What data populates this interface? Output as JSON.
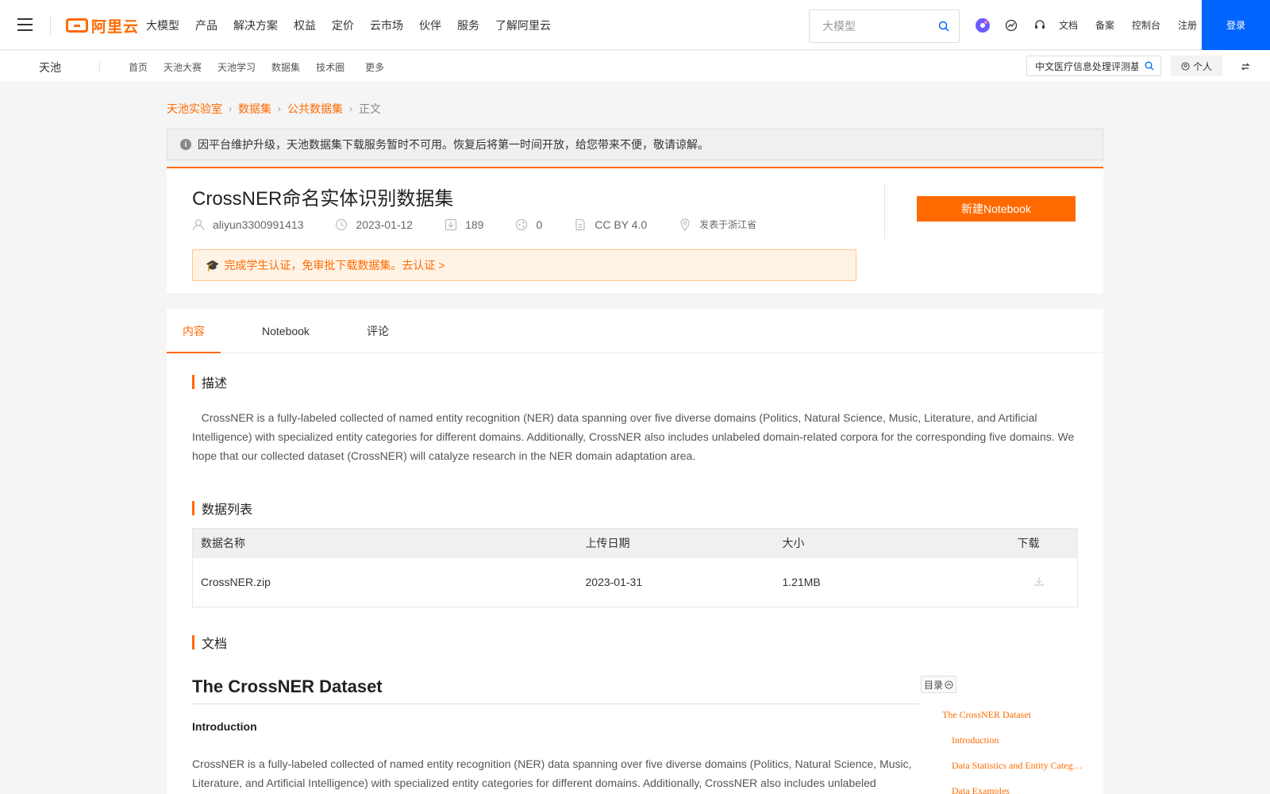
{
  "topbar": {
    "logo_text": "阿里云",
    "nav": [
      "大模型",
      "产品",
      "解决方案",
      "权益",
      "定价",
      "云市场",
      "伙伴",
      "服务",
      "了解阿里云"
    ],
    "search_placeholder": "大模型",
    "links": [
      "文档",
      "备案",
      "控制台",
      "注册"
    ],
    "login_label": "登录",
    "icons": [
      "menu-icon",
      "search-icon",
      "ai-assistant-icon",
      "activity-icon",
      "headset-icon"
    ]
  },
  "subbar": {
    "brand": "天池",
    "nav": [
      "首页",
      "天池大赛",
      "天池学习",
      "数据集",
      "技术圈",
      "更多"
    ],
    "search_value": "中文医疗信息处理评测基",
    "personal_label": "个人"
  },
  "breadcrumb": [
    "天池实验室",
    "数据集",
    "公共数据集",
    "正文"
  ],
  "notice": "因平台维护升级，天池数据集下载服务暂时不可用。恢复后将第一时间开放，给您带来不便，敬请谅解。",
  "dataset": {
    "title": "CrossNER命名实体识别数据集",
    "author": "aliyun3300991413",
    "date": "2023-01-12",
    "downloads": "189",
    "shares": "0",
    "license": "CC BY 4.0",
    "location": "发表于浙江省",
    "student_banner": "完成学生认证，免审批下载数据集。去认证 >",
    "new_notebook_label": "新建Notebook"
  },
  "tabs": [
    "内容",
    "Notebook",
    "评论"
  ],
  "sections": {
    "description_title": "描述",
    "description": "CrossNER is a fully-labeled collected of named entity recognition (NER) data spanning over five diverse domains (Politics, Natural Science, Music, Literature, and Artificial Intelligence) with specialized entity categories for different domains. Additionally, CrossNER also includes unlabeled domain-related corpora for the corresponding five domains. We hope that our collected dataset (CrossNER) will catalyze research in the NER domain adaptation area.",
    "data_list_title": "数据列表",
    "doc_title": "文档"
  },
  "table": {
    "headers": [
      "数据名称",
      "上传日期",
      "大小",
      "下载"
    ],
    "rows": [
      {
        "name": "CrossNER.zip",
        "date": "2023-01-31",
        "size": "1.21MB"
      }
    ]
  },
  "doc": {
    "title": "The CrossNER Dataset",
    "h2": "Introduction",
    "paragraph": "CrossNER is a fully-labeled collected of named entity recognition (NER) data spanning over five diverse domains (Politics, Natural Science, Music, Literature, and Artificial Intelligence) with specialized entity categories for different domains. Additionally, CrossNER also includes unlabeled",
    "toc_label": "目录",
    "toc": [
      "The CrossNER Dataset",
      "Introduction",
      "Data Statistics and Entity Categories",
      "Data Examples"
    ]
  },
  "colors": {
    "accent": "#ff6a00",
    "login_blue": "#0064ff"
  }
}
